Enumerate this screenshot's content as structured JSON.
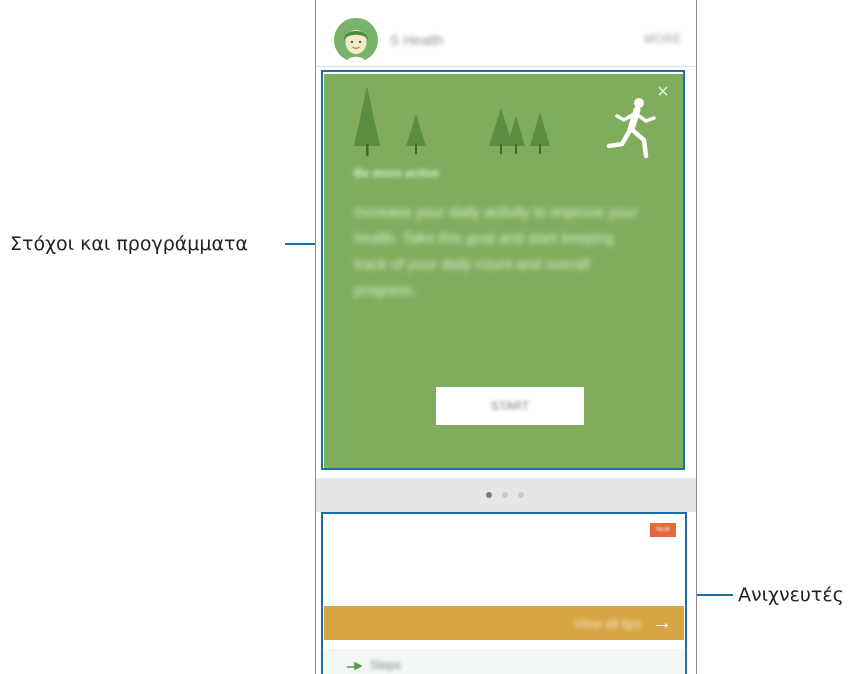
{
  "annotations": {
    "goals_label": "Στόχοι και προγράμματα",
    "trackers_label": "Ανιχνευτές"
  },
  "header": {
    "title": "S Health",
    "more_label": "MORE"
  },
  "goals_card": {
    "close_icon": "close-icon",
    "heading": "Be more active",
    "body": "Increase your daily activity to improve your health. Take this goal and start keeping track of your daily count and overall progress.",
    "start_button": "START",
    "background_color": "#7fad5d"
  },
  "pager": {
    "count": 3,
    "active_index": 0
  },
  "trackers_card": {
    "badge": "NEW",
    "tips_label": "View all tips",
    "tips_color": "#d6a544",
    "steps_label": "Steps"
  },
  "colors": {
    "annotation_line": "#1a6fa8",
    "badge": "#e16a3a"
  }
}
